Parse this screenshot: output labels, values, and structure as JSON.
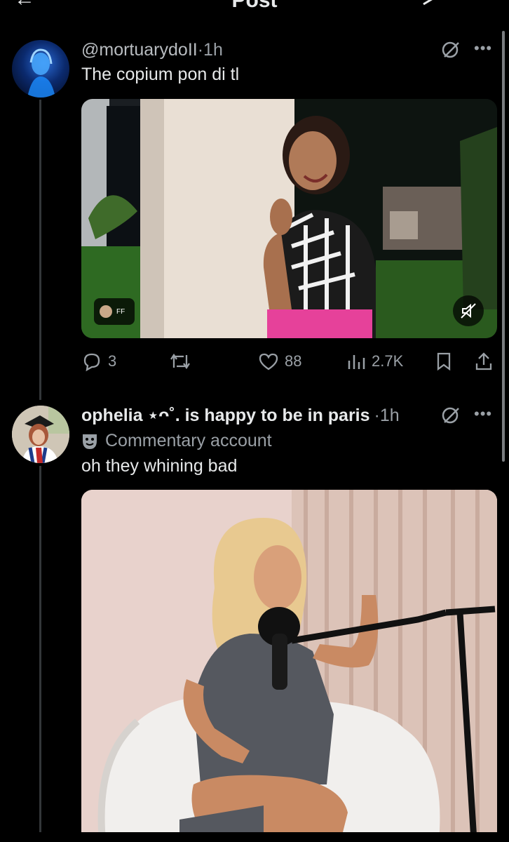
{
  "header": {
    "title": "Post"
  },
  "post1": {
    "handle": "@mortuarydoII",
    "separator": "·",
    "time": "1h",
    "text": "The copium pon di tl",
    "video_tag": "FF",
    "replies": "3",
    "likes": "88",
    "views": "2.7K"
  },
  "post2": {
    "display_name": "ophelia ⋆ ˚｡⋆୨୧˚. is happy to be in paris",
    "display_name_short": "ophelia ⋆ᴖ˚. is happy to be in paris",
    "separator": "·",
    "time": "1h",
    "label_text": "Commentary account",
    "text": "oh they whining bad"
  },
  "colors": {
    "background": "#000000",
    "text": "#e7e9ea",
    "muted": "#9aa0a6"
  }
}
